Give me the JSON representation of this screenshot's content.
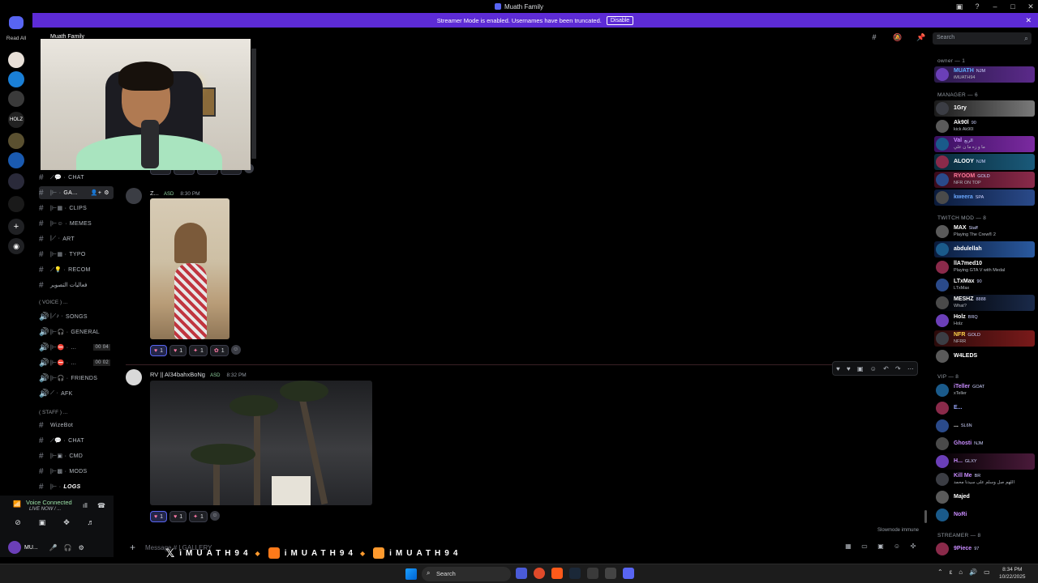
{
  "window": {
    "title": "Muath Family"
  },
  "banner": {
    "text": "Streamer Mode is enabled. Usernames have been truncated.",
    "button": "Disable"
  },
  "rail": {
    "read_all": "Read All",
    "holz_label": "HOLZ"
  },
  "server_header": {
    "name": "Muath Family"
  },
  "channels": [
    {
      "name": "CHAT",
      "icon": "chat-bubble-icon"
    },
    {
      "name": "GA...",
      "icon": "gallery-icon",
      "active": true
    },
    {
      "name": "CLIPS",
      "icon": "clips-icon"
    },
    {
      "name": "MEMES",
      "icon": "memes-icon"
    },
    {
      "name": "ART",
      "icon": "art-icon"
    },
    {
      "name": "TYPO",
      "icon": "typo-icon"
    },
    {
      "name": "RECOM",
      "icon": "bulb-icon"
    },
    {
      "name": "فعاليات التصوير",
      "icon": ""
    }
  ],
  "voice_category": "( VOICE ) ...",
  "voice_channels": [
    {
      "name": "SONGS",
      "icon": "music-icon"
    },
    {
      "name": "GENERAL",
      "icon": "headset-icon"
    },
    {
      "name": "...",
      "icon": "no-entry-icon",
      "count": "00 04"
    },
    {
      "name": "...",
      "icon": "no-entry-icon",
      "count": "00 02"
    },
    {
      "name": "FRIENDS",
      "icon": "headset-icon"
    },
    {
      "name": "AFK",
      "icon": "afk-icon"
    }
  ],
  "staff_category": "( STAFF ) ...",
  "staff_channels": [
    {
      "name": "WizeBot",
      "icon": ""
    },
    {
      "name": "CHAT",
      "icon": "chat-bubble-icon"
    },
    {
      "name": "CMD",
      "icon": "cmd-icon"
    },
    {
      "name": "MODS",
      "icon": "mods-icon"
    },
    {
      "name": "LOGS",
      "icon": "logs-icon"
    }
  ],
  "search": {
    "placeholder": "Search"
  },
  "messages": [
    {
      "user": "Z...",
      "tag": "ASD",
      "time": "8:30 PM",
      "reactions": [
        {
          "emoji": "♥",
          "count": "1",
          "on": true
        },
        {
          "emoji": "♥",
          "count": "1"
        },
        {
          "emoji": "✦",
          "count": "1"
        },
        {
          "emoji": "✿",
          "count": "1"
        }
      ]
    },
    {
      "user": "RV || Al34bahxBoNg",
      "tag": "ASD",
      "time": "8:32 PM",
      "reactions": [
        {
          "emoji": "♥",
          "count": "1",
          "on": true
        },
        {
          "emoji": "♥",
          "count": "1"
        },
        {
          "emoji": "✦",
          "count": "1"
        }
      ]
    }
  ],
  "slowmode": "Slowmode immune",
  "composer": {
    "placeholder": "Message # | GALLERY",
    "handle": "iMUATH94"
  },
  "voice_panel": {
    "status": "Voice Connected",
    "channel": "LIVE NOW / ...",
    "me": "MU..."
  },
  "member_roles": [
    {
      "label": "owner — 1",
      "members": [
        {
          "name": "MUATH",
          "badge": "NJM",
          "sub": "iMUATH94",
          "color": "#5db0ff",
          "bg": "linear-gradient(90deg,#2a1a4a,#5b2a8a)"
        }
      ]
    },
    {
      "label": "MANAGER — 6",
      "members": [
        {
          "name": "1Gry",
          "badge": "",
          "sub": "",
          "color": "#ffffff",
          "bg": "linear-gradient(90deg,#1a1a1a,#7a7a7a)"
        },
        {
          "name": "Ak90l",
          "badge": "90",
          "sub": "kick Ak90l",
          "color": "#ffffff",
          "bg": ""
        },
        {
          "name": "Val",
          "badge": "الربع",
          "sub": "ما و زه ما ن علي ",
          "color": "#c98cff",
          "bg": "linear-gradient(90deg,#3a1060,#7b2aa0)"
        },
        {
          "name": "ALOOY",
          "badge": "NJM",
          "sub": "",
          "color": "#ffffff",
          "bg": "linear-gradient(90deg,#0a2a3a,#1a5a7a)"
        },
        {
          "name": "RYOOM",
          "badge": "GOLD",
          "sub": "NFR ON TOP",
          "color": "#ff7a9a",
          "bg": "linear-gradient(90deg,#3a0a1a,#8a2a4a)"
        },
        {
          "name": "kweera",
          "badge": "SPA",
          "sub": "",
          "color": "#6aa8ff",
          "bg": "linear-gradient(90deg,#0a1a3a,#2a4a8a)"
        }
      ]
    },
    {
      "label": "TWITCH MOD — 8",
      "members": [
        {
          "name": "MAX",
          "badge": "Staff",
          "sub": "Playing The Crew® 2",
          "color": "#ffffff",
          "bg": ""
        },
        {
          "name": "abdulellah",
          "badge": "",
          "sub": "",
          "color": "#ffffff",
          "bg": "linear-gradient(90deg,#0a1a3a,#2a5aa0)"
        },
        {
          "name": "llA7med10",
          "badge": "",
          "sub": "Playing GTA V with Medal",
          "color": "#ffffff",
          "bg": ""
        },
        {
          "name": "LTxMax",
          "badge": "90",
          "sub": "LTxMax",
          "color": "#ffffff",
          "bg": ""
        },
        {
          "name": "MESHZ",
          "badge": "8888",
          "sub": "What?",
          "color": "#ffffff",
          "bg": "linear-gradient(90deg,#000,#1a2a4a)"
        },
        {
          "name": "Holz",
          "badge": "BRQ",
          "sub": "Holz",
          "color": "#ffffff",
          "bg": ""
        },
        {
          "name": "NFR",
          "badge": "GOLD",
          "sub": "NFRR",
          "color": "#ffd24a",
          "bg": "linear-gradient(90deg,#2a0a0a,#7a1a1a)"
        },
        {
          "name": "W4LEDS",
          "badge": "",
          "sub": "",
          "color": "#ffffff",
          "bg": ""
        }
      ]
    },
    {
      "label": "VIP — 8",
      "members": [
        {
          "name": "iTeller",
          "badge": "GOAT",
          "sub": "xTeller",
          "color": "#c98cff",
          "bg": ""
        },
        {
          "name": "E...",
          "badge": "",
          "sub": "",
          "color": "#9aa8ff",
          "bg": ""
        },
        {
          "name": "...",
          "badge": "SL6N",
          "sub": "",
          "color": "#ffffff",
          "bg": ""
        },
        {
          "name": "Ghosti",
          "badge": "NJM",
          "sub": "",
          "color": "#c98cff",
          "bg": ""
        },
        {
          "name": "H...",
          "badge": "GLXY",
          "sub": "",
          "color": "#c98cff",
          "bg": "linear-gradient(90deg,#000,#4a1a3a)"
        },
        {
          "name": "Kill Me",
          "badge": "BR",
          "sub": "اللهم صل وسلم على سيدنا محمد",
          "color": "#c98cff",
          "bg": ""
        },
        {
          "name": "Majed",
          "badge": "",
          "sub": "",
          "color": "#ffffff",
          "bg": ""
        },
        {
          "name": "NoRi",
          "badge": "",
          "sub": "",
          "color": "#c98cff",
          "bg": ""
        }
      ]
    },
    {
      "label": "STREAMER — 8",
      "members": [
        {
          "name": "9Piece",
          "badge": "97",
          "sub": "",
          "color": "#c98cff",
          "bg": ""
        }
      ]
    }
  ],
  "taskbar": {
    "search": "Search",
    "time": "8:34 PM",
    "date": "10/22/2025"
  }
}
